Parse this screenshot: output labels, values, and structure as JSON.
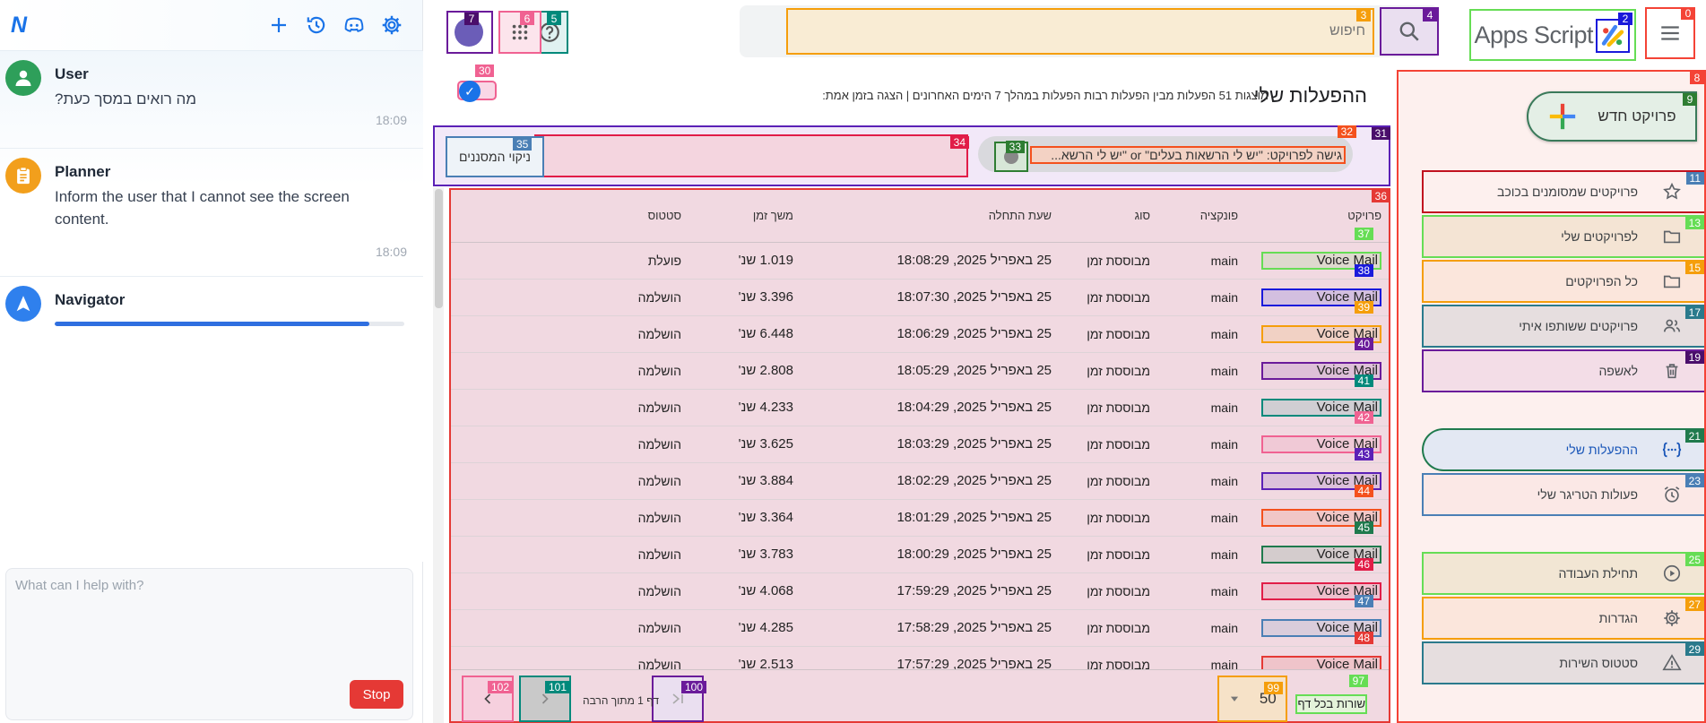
{
  "assistant": {
    "logo": "N",
    "icons": [
      "plus-icon",
      "history-icon",
      "discord-icon",
      "gear-icon"
    ],
    "messages": [
      {
        "sender": "User",
        "text": "?מה רואים במסך כעת",
        "time": "18:09"
      },
      {
        "sender": "Planner",
        "text": "Inform the user that I cannot see the screen content.",
        "time": "18:09"
      },
      {
        "sender": "Navigator",
        "text": "",
        "time": ""
      }
    ],
    "progress": 0.9,
    "input_placeholder": "What can I help with?",
    "stop_label": "Stop"
  },
  "header": {
    "brand": "Apps Script",
    "search_placeholder": "חיפוש"
  },
  "page": {
    "title": "ההפעלות שלי",
    "subtitle": "מוצגות 51 הפעלות מבין הפעלות רבות הפעלות במהלך 7 הימים האחרונים   |   הצגה בזמן אמת:"
  },
  "nav": {
    "new_project": "פרויקט חדש",
    "items": [
      {
        "label": "פרויקטים שמסומנים בכוכב",
        "icon": "star-icon"
      },
      {
        "label": "לפרויקטים שלי",
        "icon": "folder-icon"
      },
      {
        "label": "כל הפרויקטים",
        "icon": "folder-icon"
      },
      {
        "label": "פרויקטים ששותפו איתי",
        "icon": "people-icon"
      },
      {
        "label": "לאשפה",
        "icon": "trash-icon"
      },
      {
        "label": "ההפעלות שלי",
        "icon": "executions-icon"
      },
      {
        "label": "פעולות הטריגר שלי",
        "icon": "alarm-icon"
      },
      {
        "label": "תחילת העבודה",
        "icon": "play-icon"
      },
      {
        "label": "הגדרות",
        "icon": "gear-icon"
      },
      {
        "label": "סטטוס השירות",
        "icon": "warning-icon"
      }
    ]
  },
  "filters": {
    "chip": "גישה לפרויקט: \"יש לי הרשאות בעלים\" or \"יש לי הרשא...",
    "clear": "ניקוי המסננים"
  },
  "table": {
    "columns": [
      "פרויקט",
      "פונקציה",
      "סוג",
      "שעת התחלה",
      "משך זמן",
      "סטטוס"
    ],
    "rows": [
      {
        "project": "Voice Mail",
        "function": "main",
        "type": "מבוססת זמן",
        "start": "25 באפריל 2025, 18:08:29",
        "duration": "1.019 שנ'",
        "status": "פועלת"
      },
      {
        "project": "Voice Mail",
        "function": "main",
        "type": "מבוססת זמן",
        "start": "25 באפריל 2025, 18:07:30",
        "duration": "3.396 שנ'",
        "status": "הושלמה"
      },
      {
        "project": "Voice Mail",
        "function": "main",
        "type": "מבוססת זמן",
        "start": "25 באפריל 2025, 18:06:29",
        "duration": "6.448 שנ'",
        "status": "הושלמה"
      },
      {
        "project": "Voice Mail",
        "function": "main",
        "type": "מבוססת זמן",
        "start": "25 באפריל 2025, 18:05:29",
        "duration": "2.808 שנ'",
        "status": "הושלמה"
      },
      {
        "project": "Voice Mail",
        "function": "main",
        "type": "מבוססת זמן",
        "start": "25 באפריל 2025, 18:04:29",
        "duration": "4.233 שנ'",
        "status": "הושלמה"
      },
      {
        "project": "Voice Mail",
        "function": "main",
        "type": "מבוססת זמן",
        "start": "25 באפריל 2025, 18:03:29",
        "duration": "3.625 שנ'",
        "status": "הושלמה"
      },
      {
        "project": "Voice Mail",
        "function": "main",
        "type": "מבוססת זמן",
        "start": "25 באפריל 2025, 18:02:29",
        "duration": "3.884 שנ'",
        "status": "הושלמה"
      },
      {
        "project": "Voice Mail",
        "function": "main",
        "type": "מבוססת זמן",
        "start": "25 באפריל 2025, 18:01:29",
        "duration": "3.364 שנ'",
        "status": "הושלמה"
      },
      {
        "project": "Voice Mail",
        "function": "main",
        "type": "מבוססת זמן",
        "start": "25 באפריל 2025, 18:00:29",
        "duration": "3.783 שנ'",
        "status": "הושלמה"
      },
      {
        "project": "Voice Mail",
        "function": "main",
        "type": "מבוססת זמן",
        "start": "25 באפריל 2025, 17:59:29",
        "duration": "4.068 שנ'",
        "status": "הושלמה"
      },
      {
        "project": "Voice Mail",
        "function": "main",
        "type": "מבוססת זמן",
        "start": "25 באפריל 2025, 17:58:29",
        "duration": "4.285 שנ'",
        "status": "הושלמה"
      },
      {
        "project": "Voice Mail",
        "function": "main",
        "type": "מבוססת זמן",
        "start": "25 באפריל 2025, 17:57:29",
        "duration": "2.513 שנ'",
        "status": "הושלמה"
      }
    ]
  },
  "pager": {
    "rows_per_page_label": "שורות בכל דף:",
    "rows_per_page": "50",
    "page_info": "דף 1 מתוך הרבה"
  },
  "som_labels": {
    "hamburger": "0",
    "logo": "2",
    "search_input": "3",
    "search_button": "4",
    "help": "5",
    "apps": "6",
    "account": "7",
    "nav_panel": "8",
    "new_project": "9",
    "nav": [
      "11",
      "13",
      "15",
      "17",
      "19",
      "21",
      "23",
      "25",
      "27",
      "29"
    ],
    "realtime": "30",
    "filter_bar": "31",
    "chip_text": "32",
    "chip_close": "33",
    "filter_input": "34",
    "clear": "35",
    "table": "36",
    "rows": [
      "37",
      "38",
      "39",
      "40",
      "41",
      "42",
      "43",
      "44",
      "45",
      "46",
      "47",
      "48"
    ],
    "rows_label": "97",
    "rows_select": "99",
    "first_page": "100",
    "next_page": "101",
    "prev_page": "102"
  },
  "colors": {
    "accent": "#1a73e8",
    "som_red": "#f44336",
    "som_green": "#66dd55",
    "som_orange": "#f59e0b",
    "som_purple": "#6a1b9a",
    "som_teal": "#00897b",
    "som_pink": "#f06292",
    "stop": "#e53935"
  }
}
